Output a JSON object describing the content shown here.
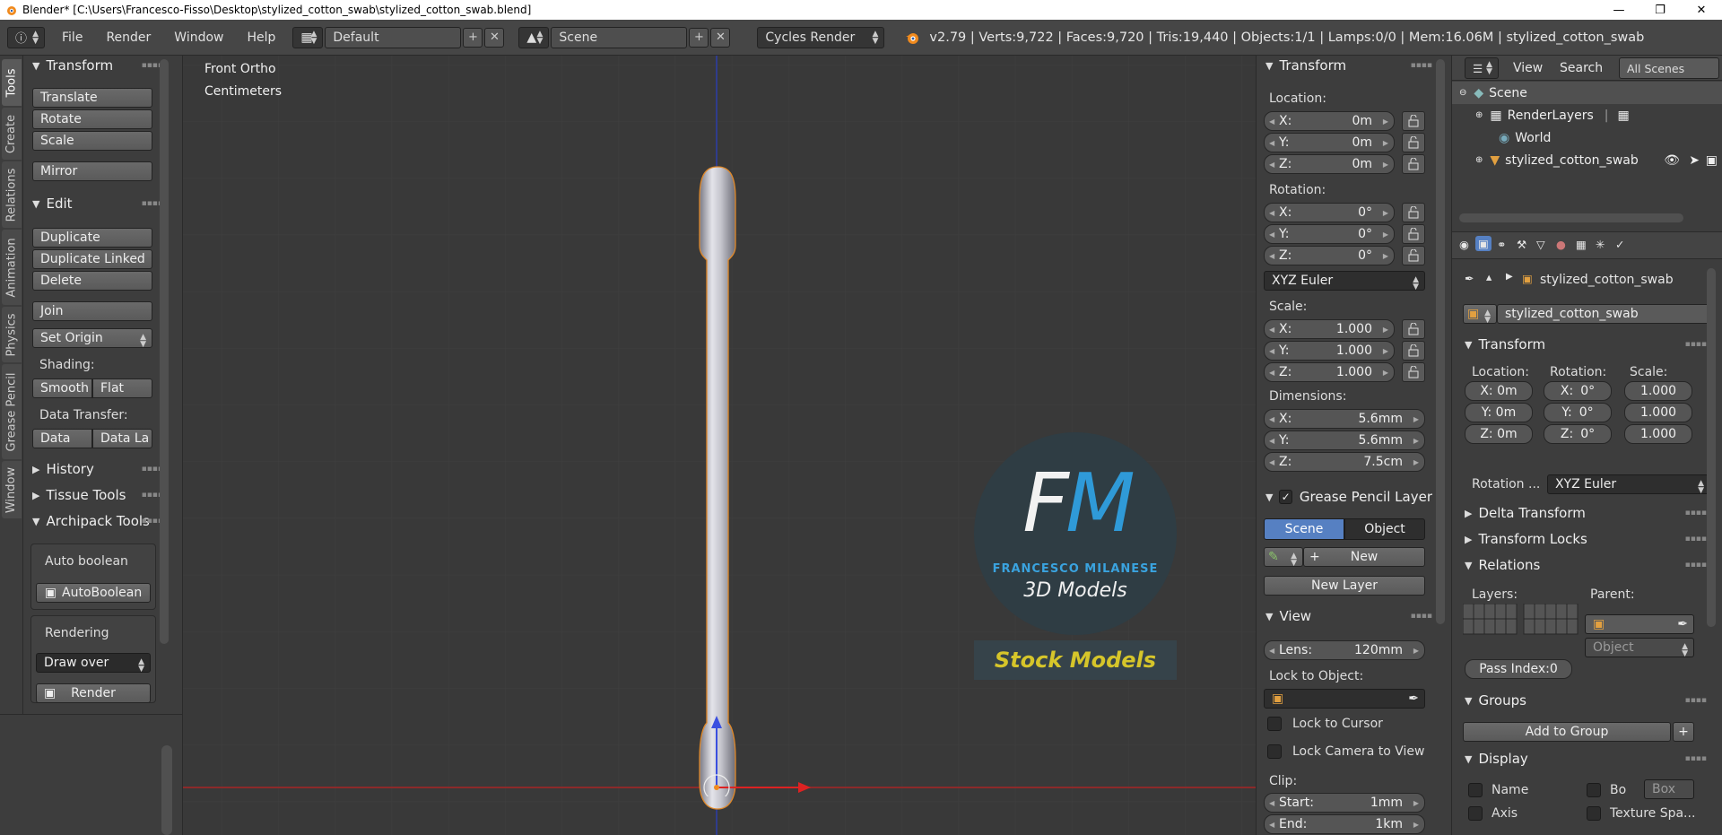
{
  "titlebar": {
    "title": "Blender* [C:\\Users\\Francesco-Fisso\\Desktop\\stylized_cotton_swab\\stylized_cotton_swab.blend]"
  },
  "infobar": {
    "menus": [
      "File",
      "Render",
      "Window",
      "Help"
    ],
    "layout": "Default",
    "scene": "Scene",
    "engine": "Cycles Render",
    "stats": "v2.79 | Verts:9,722 | Faces:9,720 | Tris:19,440 | Objects:1/1 | Lamps:0/0 | Mem:16.06M | stylized_cotton_swab"
  },
  "tabs": [
    "Tools",
    "Create",
    "Relations",
    "Animation",
    "Physics",
    "Grease Pencil",
    "Window"
  ],
  "toolshelf": {
    "transform": {
      "title": "Transform",
      "buttons": [
        "Translate",
        "Rotate",
        "Scale",
        "Mirror"
      ]
    },
    "edit": {
      "title": "Edit",
      "buttons": [
        "Duplicate",
        "Duplicate Linked",
        "Delete",
        "Join"
      ],
      "set_origin": "Set Origin",
      "shading_label": "Shading:",
      "smooth": "Smooth",
      "flat": "Flat",
      "data_transfer_label": "Data Transfer:",
      "data": "Data",
      "data_la": "Data La"
    },
    "history": "History",
    "tissue": "Tissue Tools",
    "archipack": {
      "title": "Archipack Tools",
      "auto_boolean_label": "Auto boolean",
      "auto_boolean_btn": "AutoBoolean",
      "rendering_label": "Rendering",
      "draw_over": "Draw over",
      "render_btn": "Render"
    }
  },
  "viewport": {
    "view_name": "Front Ortho",
    "units": "Centimeters",
    "logo": {
      "letters": "FM",
      "name": "FRANCESCO MILANESE",
      "subtitle": "3D Models",
      "stock": "Stock Models"
    }
  },
  "props": {
    "transform_title": "Transform",
    "location_label": "Location:",
    "location": [
      {
        "axis": "X:",
        "value": "0m"
      },
      {
        "axis": "Y:",
        "value": "0m"
      },
      {
        "axis": "Z:",
        "value": "0m"
      }
    ],
    "rotation_label": "Rotation:",
    "rotation": [
      {
        "axis": "X:",
        "value": "0°"
      },
      {
        "axis": "Y:",
        "value": "0°"
      },
      {
        "axis": "Z:",
        "value": "0°"
      }
    ],
    "rotation_mode": "XYZ Euler",
    "scale_label": "Scale:",
    "scale": [
      {
        "axis": "X:",
        "value": "1.000"
      },
      {
        "axis": "Y:",
        "value": "1.000"
      },
      {
        "axis": "Z:",
        "value": "1.000"
      }
    ],
    "dimensions_label": "Dimensions:",
    "dimensions": [
      {
        "axis": "X:",
        "value": "5.6mm"
      },
      {
        "axis": "Y:",
        "value": "5.6mm"
      },
      {
        "axis": "Z:",
        "value": "7.5cm"
      }
    ],
    "gp_title": "Grease Pencil Layer",
    "gp_scene": "Scene",
    "gp_object": "Object",
    "gp_new": "New",
    "gp_new_layer": "New Layer",
    "view_title": "View",
    "lens_label": "Lens:",
    "lens_value": "120mm",
    "lock_object_label": "Lock to Object:",
    "lock_cursor": "Lock to Cursor",
    "lock_camera": "Lock Camera to View",
    "clip_label": "Clip:",
    "clip_start_label": "Start:",
    "clip_start": "1mm",
    "clip_end_label": "End:",
    "clip_end": "1km"
  },
  "outliner": {
    "view": "View",
    "search": "Search",
    "all_scenes": "All Scenes",
    "items": [
      "Scene",
      "RenderLayers",
      "World",
      "stylized_cotton_swab"
    ]
  },
  "propeditor": {
    "object_name": "stylized_cotton_swab",
    "object_field": "stylized_cotton_swab",
    "transform_title": "Transform",
    "location_label": "Location:",
    "rotation_label": "Rotation:",
    "scale_label": "Scale:",
    "loc": [
      "X: 0m",
      "Y: 0m",
      "Z: 0m"
    ],
    "rot": [
      "X:",
      "Y:",
      "Z:"
    ],
    "rot_vals": [
      "0°",
      "0°",
      "0°"
    ],
    "scl": [
      "1.000",
      "1.000",
      "1.000"
    ],
    "rotation_mode_label": "Rotation ...",
    "rotation_mode": "XYZ Euler",
    "delta": "Delta Transform",
    "locks": "Transform Locks",
    "relations": "Relations",
    "layers_label": "Layers:",
    "parent_label": "Parent:",
    "parent_type": "Object",
    "pass_index": "Pass Index:0",
    "groups": "Groups",
    "add_group": "Add to Group",
    "display": "Display",
    "name_cb": "Name",
    "bo_cb": "Bo",
    "box_sel": "Box",
    "axis_cb": "Axis",
    "texture_cb": "Texture Spa..."
  },
  "colors": {
    "accent": "#5680c2",
    "orange": "#f08a1e",
    "gold": "#d6c52a",
    "swab": "#c8c8d0"
  }
}
